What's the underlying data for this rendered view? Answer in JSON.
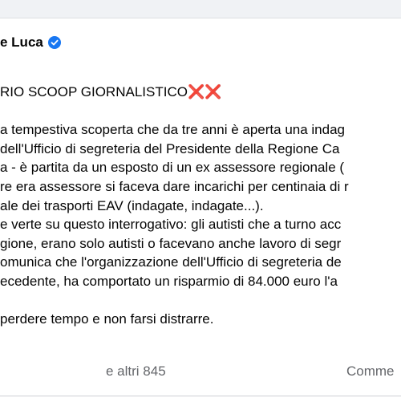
{
  "post": {
    "author": "e Luca",
    "title_text": "RIO SCOOP GIORNALISTICO",
    "title_marks": "❌❌",
    "lines": [
      "a tempestiva scoperta che da tre anni è aperta una indag",
      "dell'Ufficio di segreteria del Presidente della Regione Ca",
      "a - è partita da un esposto di un ex assessore regionale (",
      "re era assessore si faceva dare incarichi per centinaia di r",
      "ale dei trasporti EAV (indagate, indagate...).",
      "e verte su questo interrogativo: gli autisti che a turno acc",
      "gione, erano solo autisti o facevano anche lavoro di segr",
      "omunica che l'organizzazione dell'Ufficio di segreteria de",
      "ecedente, ha comportato un risparmio di 84.000 euro l'a"
    ],
    "closing_line": "perdere tempo e non farsi distrarre."
  },
  "footer": {
    "reactions_text": "e altri 845",
    "comments_text": "Comme"
  },
  "colors": {
    "verified_badge": "#1877f2",
    "x_mark": "#e0245e",
    "secondary_text": "#65676b"
  }
}
